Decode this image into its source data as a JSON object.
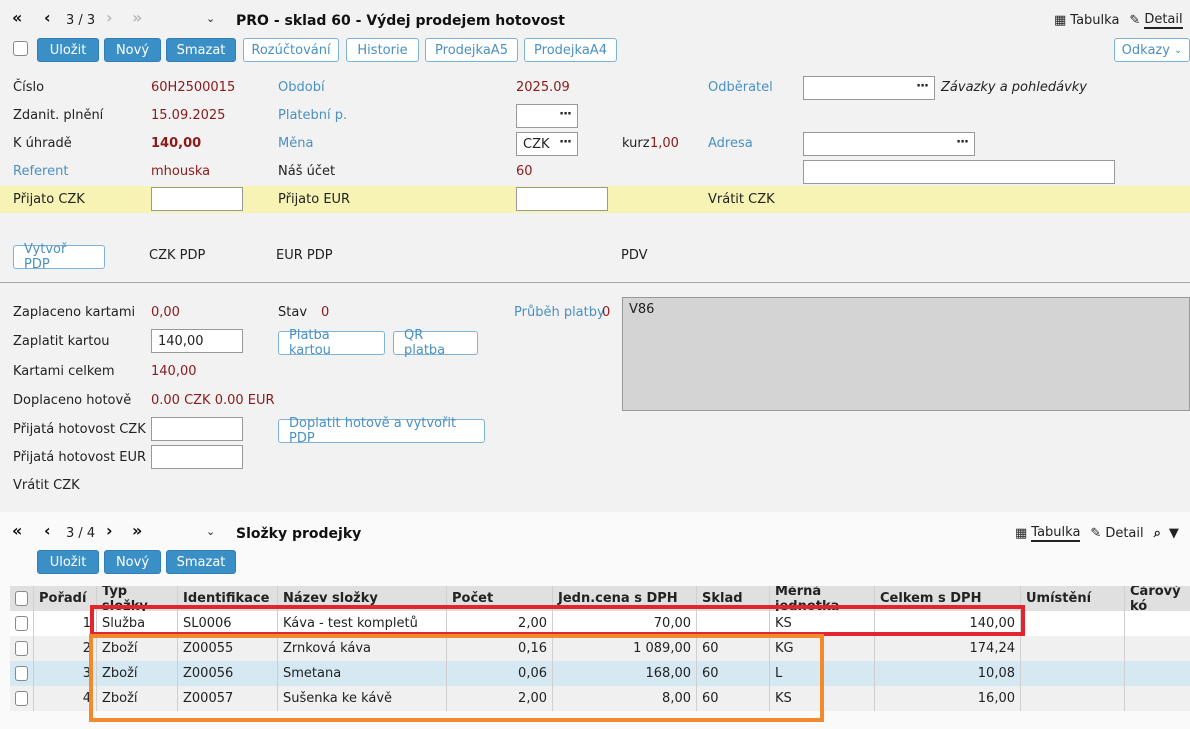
{
  "header": {
    "pager": "3 / 3",
    "title": "PRO - sklad 60 - Výdej prodejem hotovost",
    "view_table": "Tabulka",
    "view_detail": "Detail"
  },
  "toolbar": {
    "save": "Uložit",
    "new": "Nový",
    "delete": "Smazat",
    "allocation": "Rozúčtování",
    "history": "Historie",
    "receipt_a5": "ProdejkaA5",
    "receipt_a4": "ProdejkaA4",
    "links": "Odkazy"
  },
  "form": {
    "number_label": "Číslo",
    "number_value": "60H2500015",
    "period_label": "Období",
    "period_value": "2025.09",
    "customer_label": "Odběratel",
    "liabilities_text": "Závazky a pohledávky",
    "taxdate_label": "Zdanit. plnění",
    "taxdate_value": "15.09.2025",
    "payment_label": "Platební p.",
    "due_label": "K úhradě",
    "due_value": "140,00",
    "currency_label": "Měna",
    "currency_value": "CZK",
    "rate_label": "kurz",
    "rate_value": "1,00",
    "address_label": "Adresa",
    "referent_label": "Referent",
    "referent_value": "mhouska",
    "account_label": "Náš účet",
    "account_value": "60",
    "received_czk_label": "Přijato CZK",
    "received_eur_label": "Přijato EUR",
    "return_czk_label": "Vrátit CZK"
  },
  "pdp": {
    "create_button": "Vytvoř PDP",
    "czk_pdp": "CZK PDP",
    "eur_pdp": "EUR PDP",
    "pdv": "PDV"
  },
  "payment": {
    "paid_cards_label": "Zaplaceno kartami",
    "paid_cards_value": "0,00",
    "state_label": "Stav",
    "state_value": "0",
    "progress_label": "Průběh platby",
    "progress_value": "0",
    "pay_card_label": "Zaplatit kartou",
    "pay_card_value": "140,00",
    "card_pay_button": "Platba kartou",
    "qr_button": "QR platba",
    "cards_total_label": "Kartami celkem",
    "cards_total_value": "140,00",
    "cash_paid_label": "Doplaceno hotově",
    "cash_paid_value": "0.00 CZK  0.00 EUR",
    "cash_czk_label": "Přijatá hotovost CZK",
    "cash_pdp_button": "Doplatit hotově a vytvořit PDP",
    "cash_eur_label": "Přijatá hotovost EUR",
    "return_label": "Vrátit CZK",
    "box_text": "V86"
  },
  "items": {
    "pager": "3 / 4",
    "title": "Složky prodejky",
    "view_table": "Tabulka",
    "view_detail": "Detail",
    "save": "Uložit",
    "new": "Nový",
    "delete": "Smazat",
    "columns": [
      "Pořadí",
      "Typ složky",
      "Identifikace",
      "Název složky",
      "Počet",
      "Jedn.cena s DPH",
      "Sklad",
      "Měrná jednotka",
      "Celkem s DPH",
      "Umístění",
      "Čárový kó"
    ],
    "rows": [
      {
        "order": "1",
        "type": "Služba",
        "id": "SL0006",
        "name": "Káva - test kompletů",
        "qty": "2,00",
        "price": "70,00",
        "store": "",
        "unit": "KS",
        "total": "140,00"
      },
      {
        "order": "2",
        "type": "Zboží",
        "id": "Z00055",
        "name": "Zrnková káva",
        "qty": "0,16",
        "price": "1 089,00",
        "store": "60",
        "unit": "KG",
        "total": "174,24"
      },
      {
        "order": "3",
        "type": "Zboží",
        "id": "Z00056",
        "name": "Smetana",
        "qty": "0,06",
        "price": "168,00",
        "store": "60",
        "unit": "L",
        "total": "10,08"
      },
      {
        "order": "4",
        "type": "Zboží",
        "id": "Z00057",
        "name": "Sušenka ke kávě",
        "qty": "2,00",
        "price": "8,00",
        "store": "60",
        "unit": "KS",
        "total": "16,00"
      }
    ]
  },
  "colors": {
    "primary": "#3a8fc7",
    "link": "#4a90c2",
    "value": "#8b1a1a",
    "highlight_red": "#e3262e",
    "highlight_orange": "#f08a2c",
    "yellow_row": "#f6f3b4"
  }
}
